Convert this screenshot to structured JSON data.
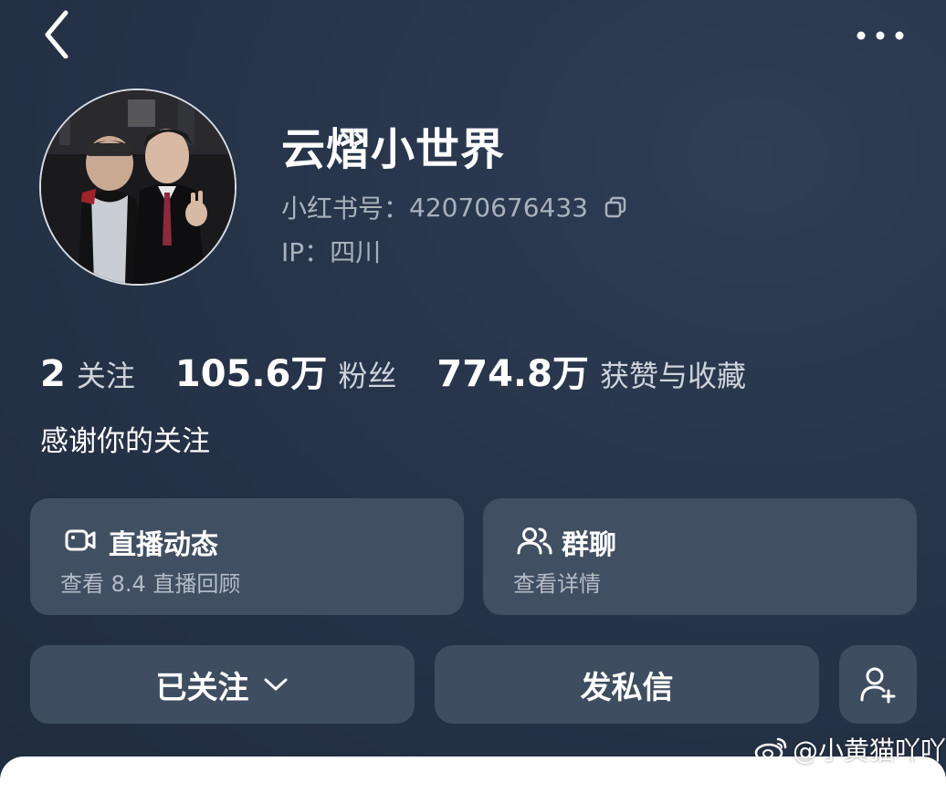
{
  "header": {
    "back_icon": "chevron-left-icon",
    "more_icon": "more-dots-icon"
  },
  "profile": {
    "name": "云熠小世界",
    "account_label": "小红书号：",
    "account_id": "42070676433",
    "copy_icon": "copy-icon",
    "ip_label": "IP：",
    "ip_value": "四川",
    "avatar": "profile-avatar-photo"
  },
  "stats": [
    {
      "value": "2",
      "label": "关注"
    },
    {
      "value": "105.6万",
      "label": "粉丝"
    },
    {
      "value": "774.8万",
      "label": "获赞与收藏"
    }
  ],
  "bio": "感谢你的关注",
  "cards": {
    "live": {
      "icon": "video-camera-icon",
      "title": "直播动态",
      "subtitle": "查看 8.4 直播回顾"
    },
    "group": {
      "icon": "group-users-icon",
      "title": "群聊",
      "subtitle": "查看详情"
    }
  },
  "actions": {
    "following_label": "已关注",
    "following_icon": "chevron-down-icon",
    "message_label": "发私信",
    "add_user_icon": "add-user-icon"
  },
  "watermark": {
    "icon": "weibo-icon",
    "text": "@小黄猫吖吖"
  },
  "colors": {
    "background": "#27344a",
    "card": "#414f62",
    "secondary_text": "#aab1bd"
  }
}
